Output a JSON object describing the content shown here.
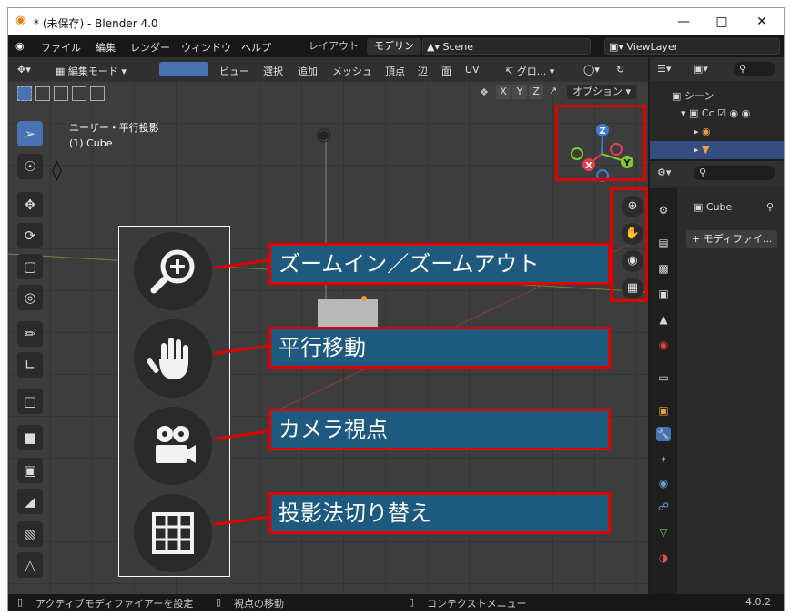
{
  "window": {
    "title": "* (未保存) - Blender 4.0"
  },
  "menu": {
    "items": [
      "ファイル",
      "編集",
      "レンダー",
      "ウィンドウ",
      "ヘルプ"
    ],
    "workspace_tabs": [
      "レイアウト",
      "モデリン"
    ],
    "scene": "Scene",
    "view_layer": "ViewLayer"
  },
  "viewport_header": {
    "mode": "編集モード",
    "menus": [
      "ビュー",
      "選択",
      "追加",
      "メッシュ",
      "頂点",
      "辺",
      "面",
      "UV"
    ],
    "transform": "グロ...",
    "axes": [
      "X",
      "Y",
      "Z"
    ],
    "options": "オプション"
  },
  "viewport": {
    "view_name": "ユーザー・平行投影",
    "object_name": "(1) Cube",
    "gizmo_axes": [
      "Z",
      "X",
      "Y"
    ]
  },
  "annotations": [
    {
      "label": "ズームイン／ズームアウト",
      "icon": "zoom-icon"
    },
    {
      "label": "平行移動",
      "icon": "hand-icon"
    },
    {
      "label": "カメラ視点",
      "icon": "camera-icon"
    },
    {
      "label": "投影法切り替え",
      "icon": "grid-icon"
    }
  ],
  "outliner": {
    "root": "シーン",
    "item1": "Cc"
  },
  "properties": {
    "object": "Cube",
    "add_modifier": "+ モディファイ..."
  },
  "status": {
    "left": "アクティブモディファイアーを設定",
    "middle": "視点の移動",
    "right": "コンテクストメニュー",
    "version": "4.0.2"
  },
  "colors": {
    "highlight": "#e00000",
    "callout_bg": "#1e5a7f",
    "active_tool": "#4772b3"
  }
}
